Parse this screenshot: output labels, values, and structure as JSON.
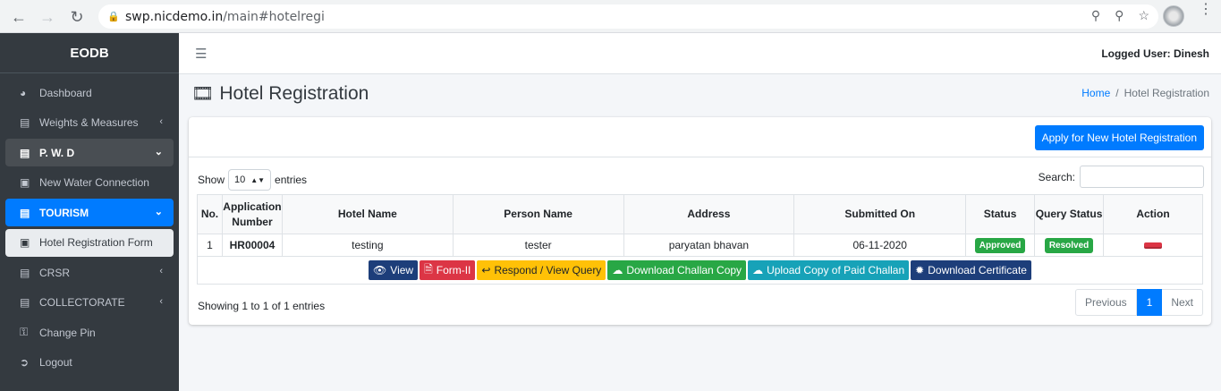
{
  "browser": {
    "url_host": "swp.nicdemo.in",
    "url_path": "/main#hotelregi"
  },
  "sidebar": {
    "brand": "EODB",
    "items": [
      {
        "label": "Dashboard",
        "icon": "dashboard-icon"
      },
      {
        "label": "Weights & Measures",
        "icon": "list-icon"
      },
      {
        "label": "P. W. D",
        "icon": "list-icon"
      },
      {
        "label": "New Water Connection",
        "icon": "id-card-icon"
      },
      {
        "label": "TOURISM",
        "icon": "list-icon"
      },
      {
        "label": "Hotel Registration Form",
        "icon": "id-card-icon"
      },
      {
        "label": "CRSR",
        "icon": "list-icon"
      },
      {
        "label": "COLLECTORATE",
        "icon": "list-icon"
      },
      {
        "label": "Change Pin",
        "icon": "key-icon"
      },
      {
        "label": "Logout",
        "icon": "logout-icon"
      }
    ]
  },
  "topbar": {
    "logged_user": "Logged User: Dinesh"
  },
  "page": {
    "title": "Hotel Registration",
    "breadcrumb_home": "Home",
    "breadcrumb_sep": "/",
    "breadcrumb_current": "Hotel Registration"
  },
  "card": {
    "apply_button": "Apply for New Hotel Registration",
    "show_label": "Show",
    "entries_label": "entries",
    "page_length": "10",
    "search_label": "Search:",
    "columns": [
      "No.",
      "Application Number",
      "Hotel Name",
      "Person Name",
      "Address",
      "Submitted On",
      "Status",
      "Query Status",
      "Action"
    ],
    "rows": [
      {
        "no": "1",
        "app_no": "HR00004",
        "hotel": "testing",
        "person": "tester",
        "address": "paryatan bhavan",
        "submitted": "06-11-2020",
        "status": "Approved",
        "query_status": "Resolved"
      }
    ],
    "actions": {
      "view": "View",
      "form": "Form-II",
      "respond": "Respond / View Query",
      "challan": "Download Challan Copy",
      "upload": "Upload Copy of Paid Challan",
      "certificate": "Download Certificate"
    },
    "info": "Showing 1 to 1 of 1 entries",
    "pager": {
      "previous": "Previous",
      "current": "1",
      "next": "Next"
    }
  },
  "colors": {
    "primary": "#007bff",
    "sidebar": "#343a40",
    "success": "#28a745",
    "danger": "#dc3545",
    "warning": "#ffc107",
    "info": "#17a2b8",
    "navy": "#1d3e7a"
  }
}
